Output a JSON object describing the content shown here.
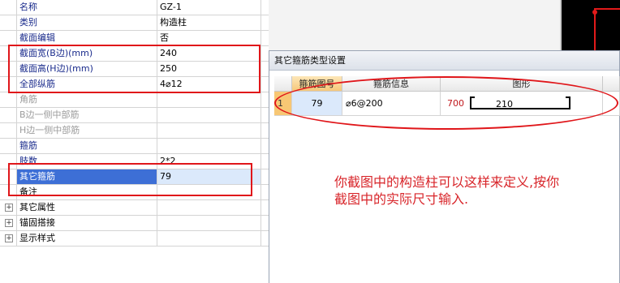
{
  "property_grid": {
    "rows": [
      {
        "name": "名称",
        "value": "GZ-1",
        "checkbox": false,
        "expander": false
      },
      {
        "name": "类别",
        "value": "构造柱",
        "checkbox": true,
        "expander": false
      },
      {
        "name": "截面编辑",
        "value": "否",
        "checkbox": false,
        "expander": false
      },
      {
        "name": "截面宽(B边)(mm)",
        "value": "240",
        "checkbox": true,
        "expander": false
      },
      {
        "name": "截面高(H边)(mm)",
        "value": "250",
        "checkbox": false,
        "expander": false
      },
      {
        "name": "全部纵筋",
        "value": "4⌀12",
        "checkbox": false,
        "expander": false
      },
      {
        "name": "角筋",
        "value": "",
        "checkbox": false,
        "expander": false
      },
      {
        "name": "B边一侧中部筋",
        "value": "",
        "checkbox": false,
        "expander": false
      },
      {
        "name": "H边一侧中部筋",
        "value": "",
        "checkbox": false,
        "expander": false
      },
      {
        "name": "箍筋",
        "value": "",
        "checkbox": false,
        "expander": false
      },
      {
        "name": "肢数",
        "value": "2*2",
        "checkbox": false,
        "expander": false
      },
      {
        "name": "其它箍筋",
        "value": "79",
        "checkbox": false,
        "expander": false
      },
      {
        "name": "备注",
        "value": "",
        "checkbox": false,
        "expander": false
      },
      {
        "name": "其它属性",
        "value": "",
        "checkbox": false,
        "expander": true
      },
      {
        "name": "锚固搭接",
        "value": "",
        "checkbox": false,
        "expander": true
      },
      {
        "name": "显示样式",
        "value": "",
        "checkbox": false,
        "expander": true
      }
    ],
    "expander_symbol": "+"
  },
  "dialog": {
    "title": "其它箍筋类型设置",
    "columns": {
      "no": "箍筋图号",
      "info": "箍筋信息",
      "shape": "图形"
    },
    "row": {
      "index": "1",
      "no": "79",
      "info": "⌀6@200",
      "dim_left": "700",
      "dim_inner": "210"
    }
  },
  "annotation": {
    "line1": "你截图中的构造柱可以这样来定义,按你",
    "line2": "截图中的实际尺寸输入."
  },
  "colors": {
    "annotation_red": "#e0161a",
    "label_blue": "#1a2b8c",
    "selection_blue": "#3d6fd6",
    "header_orange": "#f6c87a"
  }
}
